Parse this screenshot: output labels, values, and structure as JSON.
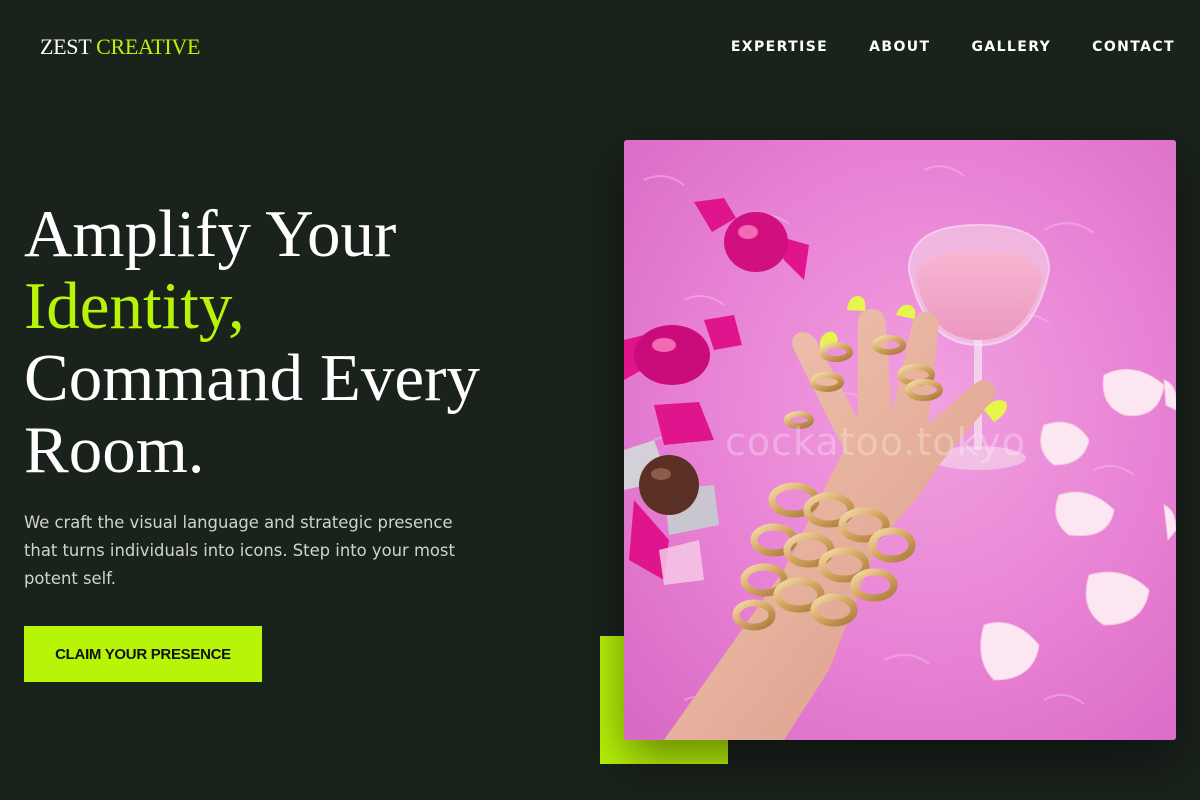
{
  "header": {
    "logo_primary": "ZEST",
    "logo_accent": "CREATIVE",
    "nav": [
      "EXPERTISE",
      "ABOUT",
      "GALLERY",
      "CONTACT"
    ]
  },
  "hero": {
    "title_line1": "Amplify Your",
    "title_accent": "Identity,",
    "title_line3": "Command Every",
    "title_line4": "Room.",
    "subtitle": "We craft the visual language and strategic presence that turns individuals into icons. Step into your most potent self.",
    "cta_label": "CLAIM YOUR PRESENCE",
    "image_watermark": "cockatoo.tokyo"
  },
  "colors": {
    "background": "#1a221c",
    "accent": "#b8f408",
    "text": "#ffffff",
    "muted_text": "#cfd3cf"
  }
}
